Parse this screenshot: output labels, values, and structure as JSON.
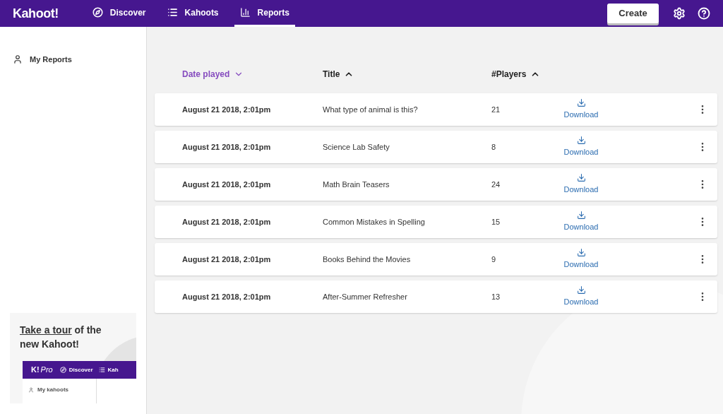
{
  "header": {
    "logo": "Kahoot!",
    "nav": [
      {
        "label": "Discover",
        "kind": "compass",
        "selected": false
      },
      {
        "label": "Kahoots",
        "kind": "list",
        "selected": false
      },
      {
        "label": "Reports",
        "kind": "chart",
        "selected": true
      }
    ],
    "create_button": "Create"
  },
  "sidebar": {
    "items": [
      {
        "label": "My Reports",
        "selected": true
      }
    ],
    "tour_card": {
      "link": "Take a tour",
      "text": " of the new Kahoot!",
      "preview": {
        "logo": "K!",
        "plan": "Pro",
        "nav": [
          {
            "label": "Discover",
            "kind": "compass"
          },
          {
            "label": "Kah",
            "kind": "list"
          }
        ],
        "sidebar_item": "My kahoots"
      }
    }
  },
  "table": {
    "columns": [
      {
        "label": "Date played",
        "selected": true,
        "ascending": false
      },
      {
        "label": "Title",
        "selected": false,
        "ascending": true
      },
      {
        "label": "#Players",
        "selected": false,
        "ascending": true
      }
    ],
    "rows": [
      {
        "date": "August 21 2018, 2:01pm",
        "title": "What type of animal is this?",
        "players": "21",
        "action": "Download"
      },
      {
        "date": "August 21 2018, 2:01pm",
        "title": "Science Lab Safety",
        "players": "8",
        "action": "Download"
      },
      {
        "date": "August 21 2018, 2:01pm",
        "title": "Math Brain Teasers",
        "players": "24",
        "action": "Download"
      },
      {
        "date": "August 21 2018, 2:01pm",
        "title": "Common Mistakes in Spelling",
        "players": "15",
        "action": "Download"
      },
      {
        "date": "August 21 2018, 2:01pm",
        "title": "Books Behind the Movies",
        "players": "9",
        "action": "Download"
      },
      {
        "date": "August 21 2018, 2:01pm",
        "title": "After-Summer Refresher",
        "players": "13",
        "action": "Download"
      }
    ]
  }
}
